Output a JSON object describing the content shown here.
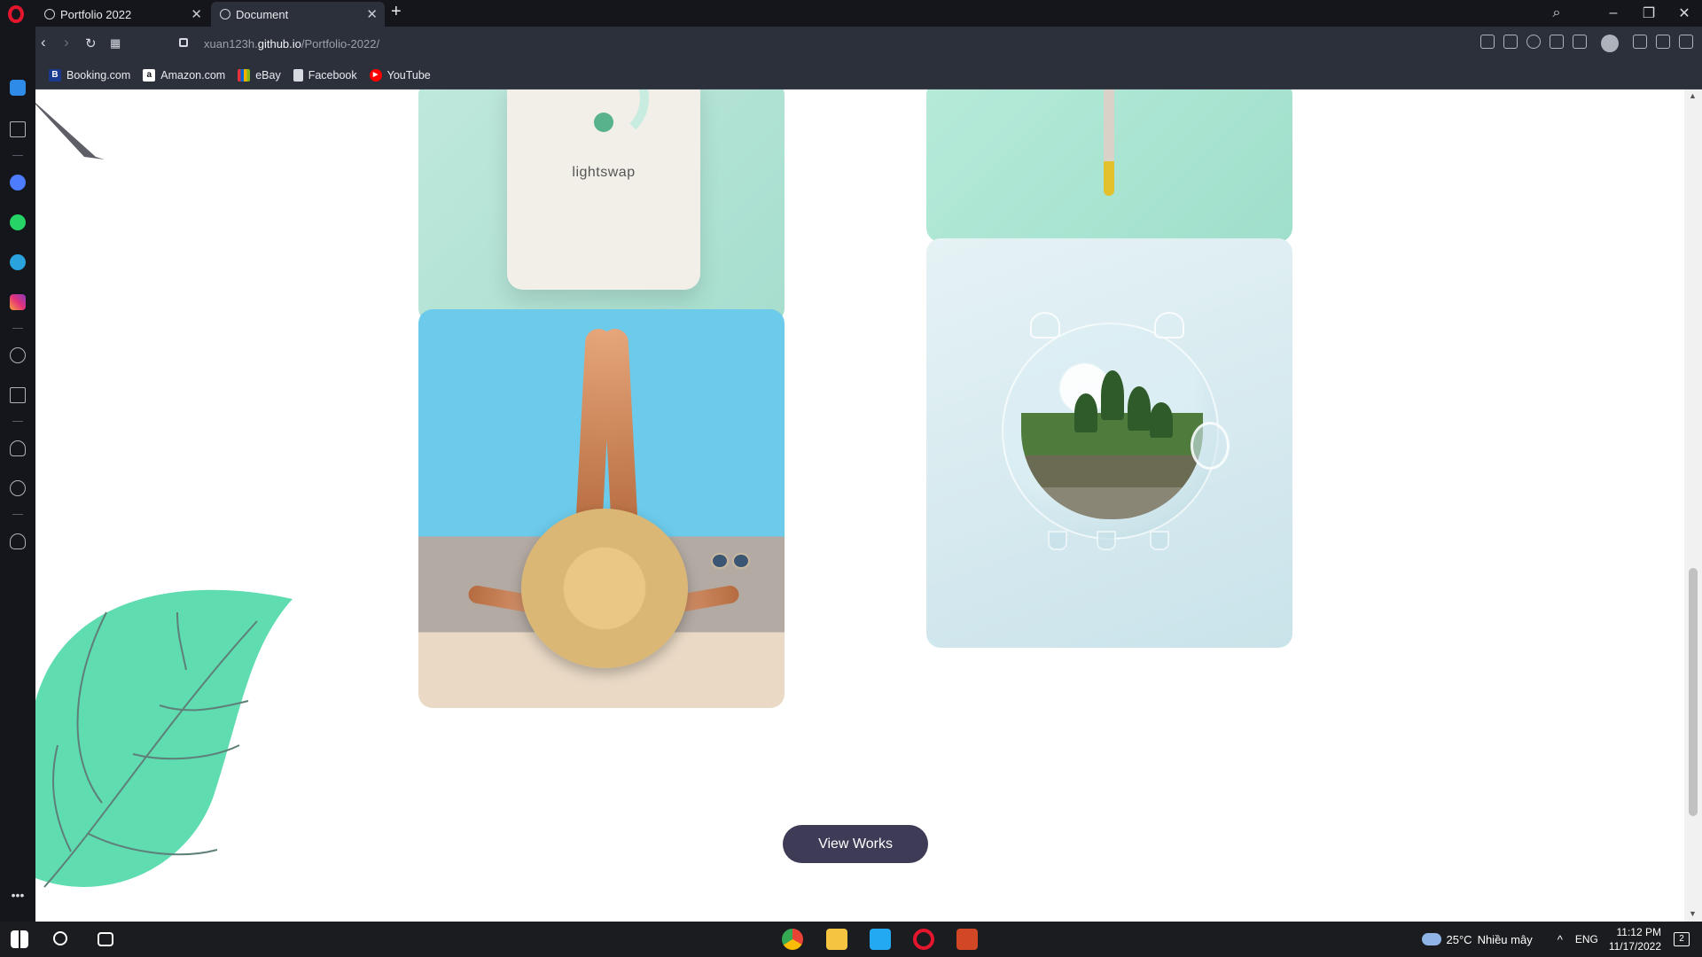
{
  "browser": {
    "tabs": [
      {
        "title": "Portfolio 2022"
      },
      {
        "title": "Document"
      }
    ],
    "url": {
      "host_prefix": "xuan123h.",
      "host_main": "github.io",
      "path": "/Portfolio-2022/"
    },
    "bookmarks": [
      {
        "label": "Booking.com",
        "icon": "booking-icon",
        "color": "#1a3a8f",
        "glyph": "B."
      },
      {
        "label": "Amazon.com",
        "icon": "amazon-icon",
        "color": "#ffffff",
        "glyph": "a"
      },
      {
        "label": "eBay",
        "icon": "ebay-icon",
        "color": "#e53238",
        "glyph": ""
      },
      {
        "label": "Facebook",
        "icon": "file-icon",
        "color": "#d7dae0",
        "glyph": ""
      },
      {
        "label": "YouTube",
        "icon": "youtube-icon",
        "color": "#ff0000",
        "glyph": "▶"
      }
    ]
  },
  "page": {
    "bag_text": "lightswap",
    "cta_label": "View Works"
  },
  "taskbar": {
    "weather_temp": "25°C",
    "weather_text": "Nhiều mây",
    "language": "ENG",
    "time": "11:12 PM",
    "date": "11/17/2022",
    "notification_count": "2"
  },
  "colors": {
    "accent_button": "#3e3b56",
    "leaf": "#5fdcb0",
    "opera_red": "#e3162e"
  }
}
